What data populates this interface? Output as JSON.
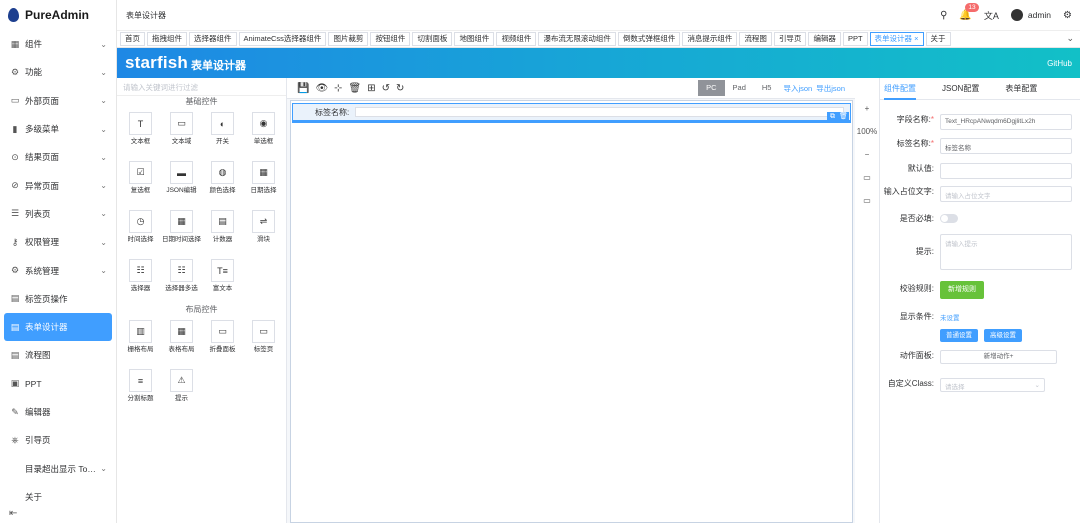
{
  "app": {
    "title": "PureAdmin"
  },
  "sidebar": {
    "items": [
      {
        "icon": "▦",
        "label": "组件",
        "chev": "⌄"
      },
      {
        "icon": "⚙",
        "label": "功能",
        "chev": "⌄"
      },
      {
        "icon": "▭",
        "label": "外部页面",
        "chev": "⌄"
      },
      {
        "icon": "▮",
        "label": "多级菜单",
        "chev": "⌄"
      },
      {
        "icon": "⊙",
        "label": "结果页面",
        "chev": "⌄"
      },
      {
        "icon": "⊘",
        "label": "异常页面",
        "chev": "⌄"
      },
      {
        "icon": "☰",
        "label": "列表页",
        "chev": "⌄"
      },
      {
        "icon": "⚷",
        "label": "权限管理",
        "chev": "⌄"
      },
      {
        "icon": "⚙",
        "label": "系统管理",
        "chev": "⌄"
      },
      {
        "icon": "▤",
        "label": "标签页操作",
        "chev": ""
      },
      {
        "icon": "▤",
        "label": "表单设计器",
        "chev": ""
      },
      {
        "icon": "▤",
        "label": "流程图",
        "chev": ""
      },
      {
        "icon": "▣",
        "label": "PPT",
        "chev": ""
      },
      {
        "icon": "✎",
        "label": "编辑器",
        "chev": ""
      },
      {
        "icon": "⎈",
        "label": "引导页",
        "chev": ""
      },
      {
        "icon": "",
        "label": "目录超出显示 Tooltip...",
        "chev": "⌄"
      },
      {
        "icon": "",
        "label": "关于",
        "chev": ""
      }
    ],
    "collapse_icon": "⇤"
  },
  "header": {
    "breadcrumb": "表单设计器",
    "notice_count": "13",
    "user": "admin"
  },
  "tabs": [
    {
      "label": "首页"
    },
    {
      "label": "拖拽组件"
    },
    {
      "label": "选择器组件"
    },
    {
      "label": "AnimateCss选择器组件"
    },
    {
      "label": "图片裁剪"
    },
    {
      "label": "按钮组件"
    },
    {
      "label": "切割面板"
    },
    {
      "label": "地图组件"
    },
    {
      "label": "视频组件"
    },
    {
      "label": "瀑布流无限滚动组件"
    },
    {
      "label": "倒数式弹框组件"
    },
    {
      "label": "消息提示组件"
    },
    {
      "label": "流程图"
    },
    {
      "label": "引导页"
    },
    {
      "label": "编辑器"
    },
    {
      "label": "PPT"
    },
    {
      "label": "表单设计器 ×"
    },
    {
      "label": "关于"
    }
  ],
  "banner": {
    "brand": "starfish",
    "sub": "表单设计器",
    "github": "GitHub"
  },
  "left_panel": {
    "search_placeholder": "请输入关键词进行过滤",
    "basic_title": "基础控件",
    "basic": [
      {
        "icon": "T",
        "label": "文本框"
      },
      {
        "icon": "▭",
        "label": "文本域"
      },
      {
        "icon": "◐",
        "label": "开关"
      },
      {
        "icon": "◉",
        "label": "单选框"
      },
      {
        "icon": "☑",
        "label": "复选框"
      },
      {
        "icon": "▬",
        "label": "JSON编辑"
      },
      {
        "icon": "◍",
        "label": "颜色选择"
      },
      {
        "icon": "▦",
        "label": "日期选择"
      },
      {
        "icon": "◷",
        "label": "时间选择"
      },
      {
        "icon": "▦",
        "label": "日期时间选择"
      },
      {
        "icon": "▤",
        "label": "计数器"
      },
      {
        "icon": "⇌",
        "label": "滑块"
      },
      {
        "icon": "☷",
        "label": "选择器"
      },
      {
        "icon": "☷",
        "label": "选择器多选"
      },
      {
        "icon": "T≡",
        "label": "富文本"
      }
    ],
    "layout_title": "布局控件",
    "layout": [
      {
        "icon": "▥",
        "label": "栅格布局"
      },
      {
        "icon": "▦",
        "label": "表格布局"
      },
      {
        "icon": "▭",
        "label": "折叠面板"
      },
      {
        "icon": "▭",
        "label": "标签页"
      },
      {
        "icon": "≡",
        "label": "分割标题"
      },
      {
        "icon": "⚠",
        "label": "提示"
      }
    ]
  },
  "canvas": {
    "toolbar_icons": [
      "💾",
      "👁",
      "⊹",
      "🗑",
      "⊞",
      "↺",
      "↻"
    ],
    "devices": [
      "PC",
      "Pad",
      "H5"
    ],
    "import_json": "导入json",
    "export_json": "导出json",
    "field_label": "标签名称:"
  },
  "mid_tools": [
    "+",
    "100%",
    "−",
    "▭",
    "▭"
  ],
  "right_panel": {
    "tabs": [
      "组件配置",
      "JSON配置",
      "表单配置"
    ],
    "field_name_label": "字段名称:",
    "field_name_value": "Text_HRcpANwqdm6DgjlitLx2h",
    "label_name_label": "标签名称:",
    "label_name_value": "标签名称",
    "default_label": "默认值:",
    "placeholder_label": "输入占位文字:",
    "placeholder_value": "请输入占位文字",
    "required_label": "是否必填:",
    "tip_label": "提示:",
    "tip_placeholder": "请输入提示",
    "rule_label": "校验规则:",
    "rule_button": "新增规则",
    "cond_label": "显示条件:",
    "cond_unset": "未设置",
    "cond_simple": "普通设置",
    "cond_advanced": "高级设置",
    "action_label": "动作面板:",
    "action_button": "新增动作+",
    "class_label": "自定义Class:",
    "class_placeholder": "请选择"
  },
  "colors": {
    "primary": "#409eff",
    "success": "#67c23a",
    "danger": "#f56c6c"
  }
}
